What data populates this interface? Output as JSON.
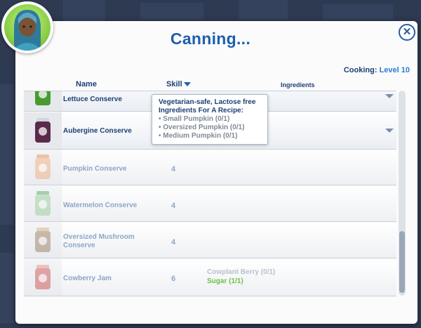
{
  "dialog": {
    "title": "Canning...",
    "cooking_label": "Cooking:",
    "cooking_level": "Level 10",
    "close_icon": "✕"
  },
  "columns": {
    "name": "Name",
    "skill": "Skill",
    "ingredients": "Ingredients"
  },
  "recipes": [
    {
      "name": "Lettuce Conserve",
      "skill": "",
      "jar_color": "#4a9a2f",
      "ingredients": []
    },
    {
      "name": "Aubergine Conserve",
      "skill": "",
      "jar_color": "#5a2a4a",
      "ingredients": []
    },
    {
      "name": "Pumpkin Conserve",
      "skill": "4",
      "jar_color": "#e07a3a",
      "ingredients": []
    },
    {
      "name": "Watermelon Conserve",
      "skill": "4",
      "jar_color": "#3f9a4a",
      "ingredients": []
    },
    {
      "name": "Oversized Mushroom Conserve",
      "skill": "4",
      "jar_color": "#8a6a4a",
      "ingredients": []
    },
    {
      "name": "Cowberry Jam",
      "skill": "6",
      "jar_color": "#c03a3a",
      "ingredients": [
        {
          "text": "Cowplant Berry (0/1)",
          "have": false
        },
        {
          "text": "Sugar (1/1)",
          "have": true
        }
      ]
    }
  ],
  "tooltip": {
    "title_line1": "Vegetarian-safe, Lactose free",
    "title_line2": "Ingredients For A Recipe:",
    "items": [
      "• Small Pumpkin (0/1)",
      "• Oversized Pumpkin (0/1)",
      "• Medium Pumpkin (0/1)"
    ]
  },
  "colors": {
    "accent": "#1d5fae",
    "have": "#6bbf4a",
    "missing": "#b9c1cc"
  }
}
